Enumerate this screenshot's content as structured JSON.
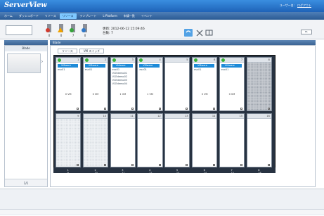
{
  "header": {
    "app_title": "ServerView",
    "user_name": "ユーザー名: ",
    "logout_label": "ログアウト"
  },
  "menu": {
    "items": [
      {
        "label": "ホーム",
        "active": false
      },
      {
        "label": "ダッシュボード",
        "active": false
      },
      {
        "label": "リソース",
        "active": false
      },
      {
        "label": "リソース",
        "active": true
      },
      {
        "label": "テンプレート",
        "active": false
      },
      {
        "label": "L-Platform",
        "active": false
      },
      {
        "label": "申請一覧",
        "active": false
      },
      {
        "label": "イベント",
        "active": false
      }
    ]
  },
  "toolbar": {
    "status_counts": [
      "0",
      "0",
      "7",
      "0"
    ],
    "updated_label": "更新: 2012-06-12 15:09:46",
    "total_label": "台数: 7",
    "download_label": "DL"
  },
  "left_panel": {
    "header": "",
    "title": "Blade",
    "pager": "1/1"
  },
  "main_panel": {
    "header": "Blade",
    "tool_buttons": [
      "リソース",
      "VM スイッチ"
    ]
  },
  "chassis": {
    "top_slots": [
      {
        "num": "1",
        "kind": "server",
        "vm_count": "0 VM"
      },
      {
        "num": "2",
        "kind": "server",
        "vm_count": "0 VM"
      },
      {
        "num": "3",
        "kind": "server",
        "vm_count": "1 VM"
      },
      {
        "num": "4",
        "kind": "server",
        "vm_count": "1 VM"
      },
      {
        "num": "5",
        "kind": "empty"
      },
      {
        "num": "6",
        "kind": "server",
        "vm_count": "0 VM"
      },
      {
        "num": "7",
        "kind": "server",
        "vm_count": "0 VM"
      },
      {
        "num": "8",
        "kind": "storage"
      }
    ],
    "bottom_slots": [
      {
        "num": "9",
        "kind": "storage"
      },
      {
        "num": "10",
        "kind": "storage"
      },
      {
        "num": "11",
        "kind": "empty"
      },
      {
        "num": "12",
        "kind": "empty"
      },
      {
        "num": "13",
        "kind": "empty"
      },
      {
        "num": "14",
        "kind": "empty"
      },
      {
        "num": "15",
        "kind": "empty"
      },
      {
        "num": "16",
        "kind": "empty"
      }
    ],
    "server_tag": "VMware",
    "host_tag": "esx01",
    "vm_tags": [
      "VCEdemo01",
      "VCEdemo02",
      "VCEdemo03",
      "VCEdemo04"
    ]
  }
}
